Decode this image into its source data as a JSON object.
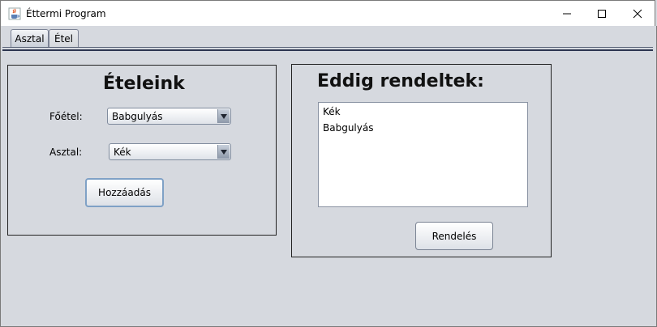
{
  "window": {
    "title": "Éttermi Program",
    "icons": {
      "app": "java-cup-icon",
      "minimize": "minimize-icon",
      "maximize": "maximize-icon",
      "close": "close-icon"
    }
  },
  "tabs": [
    {
      "label": "Asztal",
      "active": true
    },
    {
      "label": "Étel",
      "active": false
    }
  ],
  "left_panel": {
    "heading": "Ételeink",
    "main_course_label": "Főétel:",
    "main_course_value": "Babgulyás",
    "table_label": "Asztal:",
    "table_value": "Kék",
    "add_button": "Hozzáadás"
  },
  "right_panel": {
    "heading": "Eddig rendeltek:",
    "orders": [
      "Kék",
      "Babgulyás"
    ],
    "order_button": "Rendelés"
  }
}
